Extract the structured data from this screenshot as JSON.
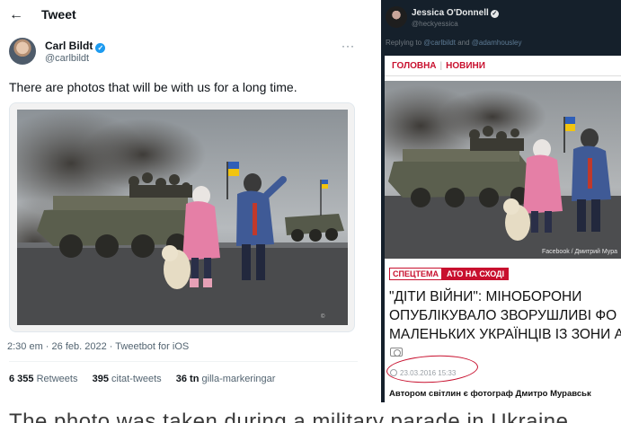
{
  "left_tweet": {
    "header_title": "Tweet",
    "author_name": "Carl Bildt",
    "author_handle": "@carlbildt",
    "tweet_text": "There are photos that will be with us for a long time.",
    "meta": {
      "time": "2:30 em",
      "date": "26 feb. 2022",
      "source": "Tweetbot for iOS"
    },
    "stats": {
      "retweets_count": "6 355",
      "retweets_label": "Retweets",
      "quotes_count": "395",
      "quotes_label": "citat-tweets",
      "likes_count": "36 tn",
      "likes_label": "gilla-markeringar"
    }
  },
  "right_reply": {
    "author_name": "Jessica O'Donnell",
    "author_handle": "@heckyessica",
    "reply_prefix": "Replying to",
    "reply_mention_1": "@carlbildt",
    "reply_and": "and",
    "reply_mention_2": "@adamhousley"
  },
  "article": {
    "nav_1": "ГОЛОВНА",
    "nav_2": "НОВИНИ",
    "photo_credit": "Facebook / Дмитрий Мура",
    "tag_1": "СПЕЦТЕМА",
    "tag_2": "АТО НА СХОДІ",
    "headline_line_1": "\"ДІТИ ВІЙНИ\": МІНОБОРОНИ",
    "headline_line_2": "ОПУБЛІКУВАЛО ЗВОРУШЛИВІ ФО",
    "headline_line_3": "МАЛЕНЬКИХ УКРАЇНЦІВ ІЗ ЗОНИ А",
    "date": "23.03.2016 15:33",
    "author_line": "Автором світлин є фотограф Дмитро Муравськ"
  },
  "bottom_caption": "The photo was taken during a military parade in Ukraine"
}
